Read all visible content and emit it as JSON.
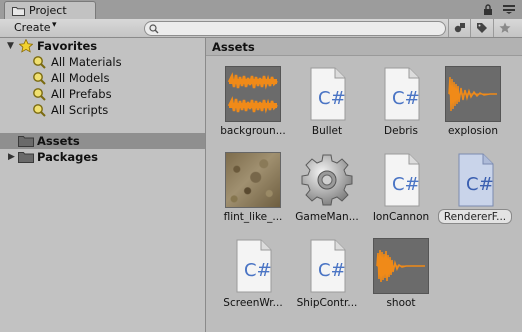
{
  "window": {
    "tab_label": "Project"
  },
  "toolbar": {
    "create_label": "Create",
    "search_value": ""
  },
  "sidebar": {
    "favorites": {
      "label": "Favorites",
      "items": [
        {
          "label": "All Materials"
        },
        {
          "label": "All Models"
        },
        {
          "label": "All Prefabs"
        },
        {
          "label": "All Scripts"
        }
      ]
    },
    "roots": [
      {
        "label": "Assets",
        "selected": true
      },
      {
        "label": "Packages",
        "selected": false
      }
    ]
  },
  "main": {
    "header": "Assets",
    "assets": [
      {
        "label": "backgroun...",
        "kind": "audio-icon"
      },
      {
        "label": "Bullet",
        "kind": "csharp-script-icon"
      },
      {
        "label": "Debris",
        "kind": "csharp-script-icon"
      },
      {
        "label": "explosion",
        "kind": "audio-icon"
      },
      {
        "label": "flint_like_...",
        "kind": "texture-icon"
      },
      {
        "label": "GameMan...",
        "kind": "gear-icon"
      },
      {
        "label": "IonCannon",
        "kind": "csharp-script-icon"
      },
      {
        "label": "RendererF...",
        "kind": "csharp-script-icon",
        "selected": true
      },
      {
        "label": "ScreenWr...",
        "kind": "csharp-script-icon"
      },
      {
        "label": "ShipContr...",
        "kind": "csharp-script-icon"
      },
      {
        "label": "shoot",
        "kind": "audio-icon"
      }
    ],
    "script_glyph": "C#"
  },
  "colors": {
    "panel": "#c2c2c2",
    "selection": "#8f8f8f",
    "waveform": "#f08a18"
  }
}
